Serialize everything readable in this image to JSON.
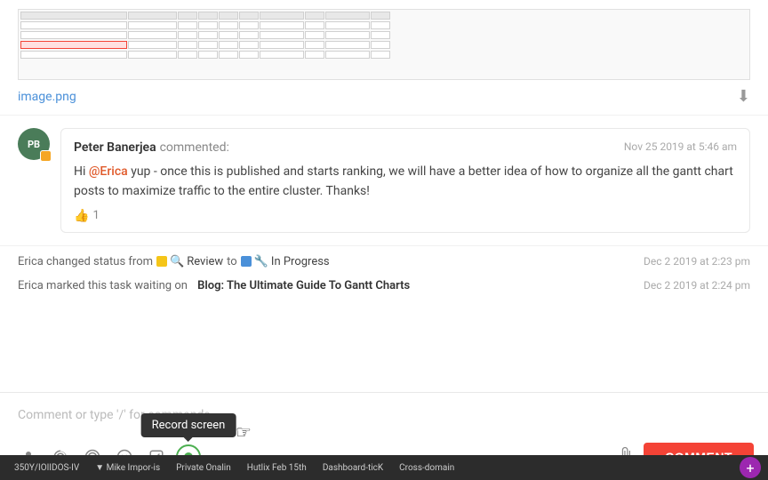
{
  "image": {
    "name": "image.png",
    "download_label": "⬇"
  },
  "comment": {
    "avatar_initials": "PB",
    "commenter_name": "Peter Banerjea",
    "commented_label": "commented:",
    "date": "Nov 25 2019 at 5:46 am",
    "mention": "@Erica",
    "text_before": "Hi ",
    "text_middle": " yup - once this is published and starts ranking, we will have a better idea of how to organize all the gantt chart posts to maximize traffic to the entire cluster. Thanks!",
    "like_count": "1"
  },
  "activity1": {
    "text_before": "Erica changed status from",
    "from_icon": "🟡",
    "from_label": "Review",
    "arrow": "to",
    "to_icon": "🔵",
    "to_label": "In Progress",
    "date": "Dec 2 2019 at 2:23 pm"
  },
  "activity2": {
    "text": "Erica marked this task waiting on",
    "link": "Blog: The Ultimate Guide To Gantt Charts",
    "date": "Dec 2 2019 at 2:24 pm"
  },
  "comment_input": {
    "placeholder": "Comment or type '/' for commands"
  },
  "toolbar": {
    "person_icon": "👤",
    "at_icon": "@",
    "emoji1_icon": "🎯",
    "emoji2_icon": "😊",
    "slash_icon": "/",
    "screen_record_tooltip": "Record screen",
    "attach_icon": "📎",
    "comment_btn_label": "COMMENT"
  },
  "taskbar": {
    "items": [
      "350Y/IOIIDOS-IV",
      "▼ Mike Impor-is",
      "Private Onalin",
      "Hutlix Feb 15th",
      "Dashboard-ticK",
      "Cross-domain"
    ]
  }
}
